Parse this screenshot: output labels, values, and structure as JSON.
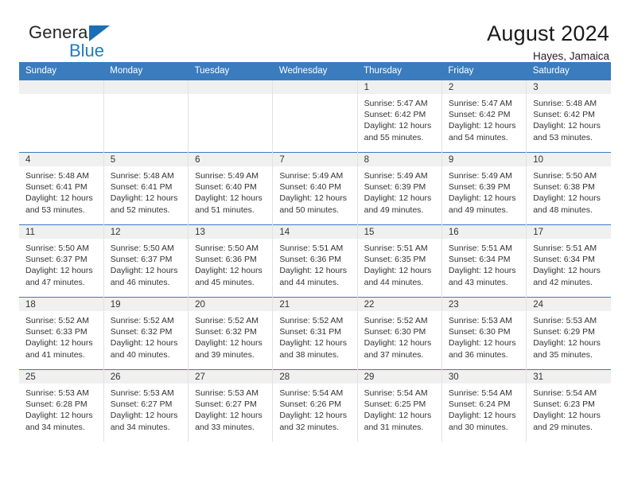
{
  "brand": {
    "name_part1": "General",
    "name_part2": "Blue",
    "triangle_color": "#1a6fb5",
    "blue_color": "#1f7bc1"
  },
  "header": {
    "title": "August 2024",
    "subtitle": "Hayes, Jamaica"
  },
  "theme": {
    "header_bg": "#3a7cbe",
    "daynum_band_bg": "#f0f0f0",
    "text_color": "#333333"
  },
  "calendar": {
    "weekday_headers": [
      "Sunday",
      "Monday",
      "Tuesday",
      "Wednesday",
      "Thursday",
      "Friday",
      "Saturday"
    ],
    "weeks": [
      [
        {
          "day": "",
          "sunrise": "",
          "sunset": "",
          "daylight_line1": "",
          "daylight_line2": ""
        },
        {
          "day": "",
          "sunrise": "",
          "sunset": "",
          "daylight_line1": "",
          "daylight_line2": ""
        },
        {
          "day": "",
          "sunrise": "",
          "sunset": "",
          "daylight_line1": "",
          "daylight_line2": ""
        },
        {
          "day": "",
          "sunrise": "",
          "sunset": "",
          "daylight_line1": "",
          "daylight_line2": ""
        },
        {
          "day": "1",
          "sunrise": "Sunrise: 5:47 AM",
          "sunset": "Sunset: 6:42 PM",
          "daylight_line1": "Daylight: 12 hours",
          "daylight_line2": "and 55 minutes."
        },
        {
          "day": "2",
          "sunrise": "Sunrise: 5:47 AM",
          "sunset": "Sunset: 6:42 PM",
          "daylight_line1": "Daylight: 12 hours",
          "daylight_line2": "and 54 minutes."
        },
        {
          "day": "3",
          "sunrise": "Sunrise: 5:48 AM",
          "sunset": "Sunset: 6:42 PM",
          "daylight_line1": "Daylight: 12 hours",
          "daylight_line2": "and 53 minutes."
        }
      ],
      [
        {
          "day": "4",
          "sunrise": "Sunrise: 5:48 AM",
          "sunset": "Sunset: 6:41 PM",
          "daylight_line1": "Daylight: 12 hours",
          "daylight_line2": "and 53 minutes."
        },
        {
          "day": "5",
          "sunrise": "Sunrise: 5:48 AM",
          "sunset": "Sunset: 6:41 PM",
          "daylight_line1": "Daylight: 12 hours",
          "daylight_line2": "and 52 minutes."
        },
        {
          "day": "6",
          "sunrise": "Sunrise: 5:49 AM",
          "sunset": "Sunset: 6:40 PM",
          "daylight_line1": "Daylight: 12 hours",
          "daylight_line2": "and 51 minutes."
        },
        {
          "day": "7",
          "sunrise": "Sunrise: 5:49 AM",
          "sunset": "Sunset: 6:40 PM",
          "daylight_line1": "Daylight: 12 hours",
          "daylight_line2": "and 50 minutes."
        },
        {
          "day": "8",
          "sunrise": "Sunrise: 5:49 AM",
          "sunset": "Sunset: 6:39 PM",
          "daylight_line1": "Daylight: 12 hours",
          "daylight_line2": "and 49 minutes."
        },
        {
          "day": "9",
          "sunrise": "Sunrise: 5:49 AM",
          "sunset": "Sunset: 6:39 PM",
          "daylight_line1": "Daylight: 12 hours",
          "daylight_line2": "and 49 minutes."
        },
        {
          "day": "10",
          "sunrise": "Sunrise: 5:50 AM",
          "sunset": "Sunset: 6:38 PM",
          "daylight_line1": "Daylight: 12 hours",
          "daylight_line2": "and 48 minutes."
        }
      ],
      [
        {
          "day": "11",
          "sunrise": "Sunrise: 5:50 AM",
          "sunset": "Sunset: 6:37 PM",
          "daylight_line1": "Daylight: 12 hours",
          "daylight_line2": "and 47 minutes."
        },
        {
          "day": "12",
          "sunrise": "Sunrise: 5:50 AM",
          "sunset": "Sunset: 6:37 PM",
          "daylight_line1": "Daylight: 12 hours",
          "daylight_line2": "and 46 minutes."
        },
        {
          "day": "13",
          "sunrise": "Sunrise: 5:50 AM",
          "sunset": "Sunset: 6:36 PM",
          "daylight_line1": "Daylight: 12 hours",
          "daylight_line2": "and 45 minutes."
        },
        {
          "day": "14",
          "sunrise": "Sunrise: 5:51 AM",
          "sunset": "Sunset: 6:36 PM",
          "daylight_line1": "Daylight: 12 hours",
          "daylight_line2": "and 44 minutes."
        },
        {
          "day": "15",
          "sunrise": "Sunrise: 5:51 AM",
          "sunset": "Sunset: 6:35 PM",
          "daylight_line1": "Daylight: 12 hours",
          "daylight_line2": "and 44 minutes."
        },
        {
          "day": "16",
          "sunrise": "Sunrise: 5:51 AM",
          "sunset": "Sunset: 6:34 PM",
          "daylight_line1": "Daylight: 12 hours",
          "daylight_line2": "and 43 minutes."
        },
        {
          "day": "17",
          "sunrise": "Sunrise: 5:51 AM",
          "sunset": "Sunset: 6:34 PM",
          "daylight_line1": "Daylight: 12 hours",
          "daylight_line2": "and 42 minutes."
        }
      ],
      [
        {
          "day": "18",
          "sunrise": "Sunrise: 5:52 AM",
          "sunset": "Sunset: 6:33 PM",
          "daylight_line1": "Daylight: 12 hours",
          "daylight_line2": "and 41 minutes."
        },
        {
          "day": "19",
          "sunrise": "Sunrise: 5:52 AM",
          "sunset": "Sunset: 6:32 PM",
          "daylight_line1": "Daylight: 12 hours",
          "daylight_line2": "and 40 minutes."
        },
        {
          "day": "20",
          "sunrise": "Sunrise: 5:52 AM",
          "sunset": "Sunset: 6:32 PM",
          "daylight_line1": "Daylight: 12 hours",
          "daylight_line2": "and 39 minutes."
        },
        {
          "day": "21",
          "sunrise": "Sunrise: 5:52 AM",
          "sunset": "Sunset: 6:31 PM",
          "daylight_line1": "Daylight: 12 hours",
          "daylight_line2": "and 38 minutes."
        },
        {
          "day": "22",
          "sunrise": "Sunrise: 5:52 AM",
          "sunset": "Sunset: 6:30 PM",
          "daylight_line1": "Daylight: 12 hours",
          "daylight_line2": "and 37 minutes."
        },
        {
          "day": "23",
          "sunrise": "Sunrise: 5:53 AM",
          "sunset": "Sunset: 6:30 PM",
          "daylight_line1": "Daylight: 12 hours",
          "daylight_line2": "and 36 minutes."
        },
        {
          "day": "24",
          "sunrise": "Sunrise: 5:53 AM",
          "sunset": "Sunset: 6:29 PM",
          "daylight_line1": "Daylight: 12 hours",
          "daylight_line2": "and 35 minutes."
        }
      ],
      [
        {
          "day": "25",
          "sunrise": "Sunrise: 5:53 AM",
          "sunset": "Sunset: 6:28 PM",
          "daylight_line1": "Daylight: 12 hours",
          "daylight_line2": "and 34 minutes."
        },
        {
          "day": "26",
          "sunrise": "Sunrise: 5:53 AM",
          "sunset": "Sunset: 6:27 PM",
          "daylight_line1": "Daylight: 12 hours",
          "daylight_line2": "and 34 minutes."
        },
        {
          "day": "27",
          "sunrise": "Sunrise: 5:53 AM",
          "sunset": "Sunset: 6:27 PM",
          "daylight_line1": "Daylight: 12 hours",
          "daylight_line2": "and 33 minutes."
        },
        {
          "day": "28",
          "sunrise": "Sunrise: 5:54 AM",
          "sunset": "Sunset: 6:26 PM",
          "daylight_line1": "Daylight: 12 hours",
          "daylight_line2": "and 32 minutes."
        },
        {
          "day": "29",
          "sunrise": "Sunrise: 5:54 AM",
          "sunset": "Sunset: 6:25 PM",
          "daylight_line1": "Daylight: 12 hours",
          "daylight_line2": "and 31 minutes."
        },
        {
          "day": "30",
          "sunrise": "Sunrise: 5:54 AM",
          "sunset": "Sunset: 6:24 PM",
          "daylight_line1": "Daylight: 12 hours",
          "daylight_line2": "and 30 minutes."
        },
        {
          "day": "31",
          "sunrise": "Sunrise: 5:54 AM",
          "sunset": "Sunset: 6:23 PM",
          "daylight_line1": "Daylight: 12 hours",
          "daylight_line2": "and 29 minutes."
        }
      ]
    ]
  }
}
